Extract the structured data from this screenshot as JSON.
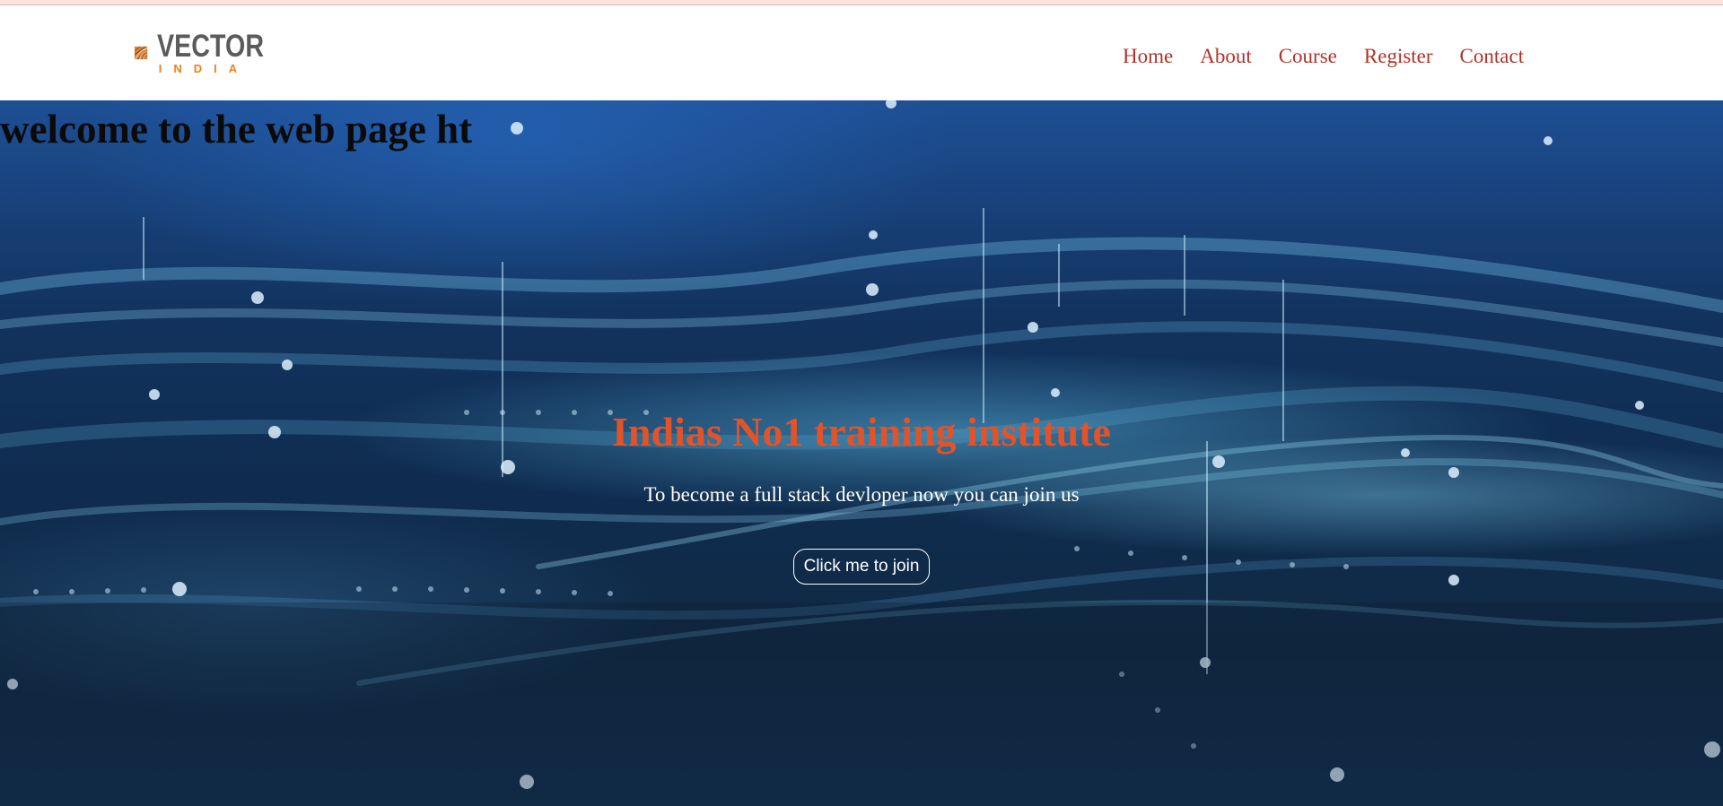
{
  "logo": {
    "word": "VECTOR",
    "sub": "INDIA",
    "icon": "vector-leaf-mark-icon",
    "colors": {
      "mark": "#f07f1f",
      "word": "#5b5b5d"
    }
  },
  "nav": {
    "items": [
      {
        "label": "Home"
      },
      {
        "label": "About"
      },
      {
        "label": "Course"
      },
      {
        "label": "Register"
      },
      {
        "label": "Contact"
      }
    ],
    "color": "#b0322a"
  },
  "hero": {
    "welcome": "welcome to the web page ht",
    "title": "Indias No1 training institute",
    "subtitle": "To become a full stack devloper now you can join us",
    "button_label": "Click me to join",
    "title_color": "#e2532a"
  }
}
